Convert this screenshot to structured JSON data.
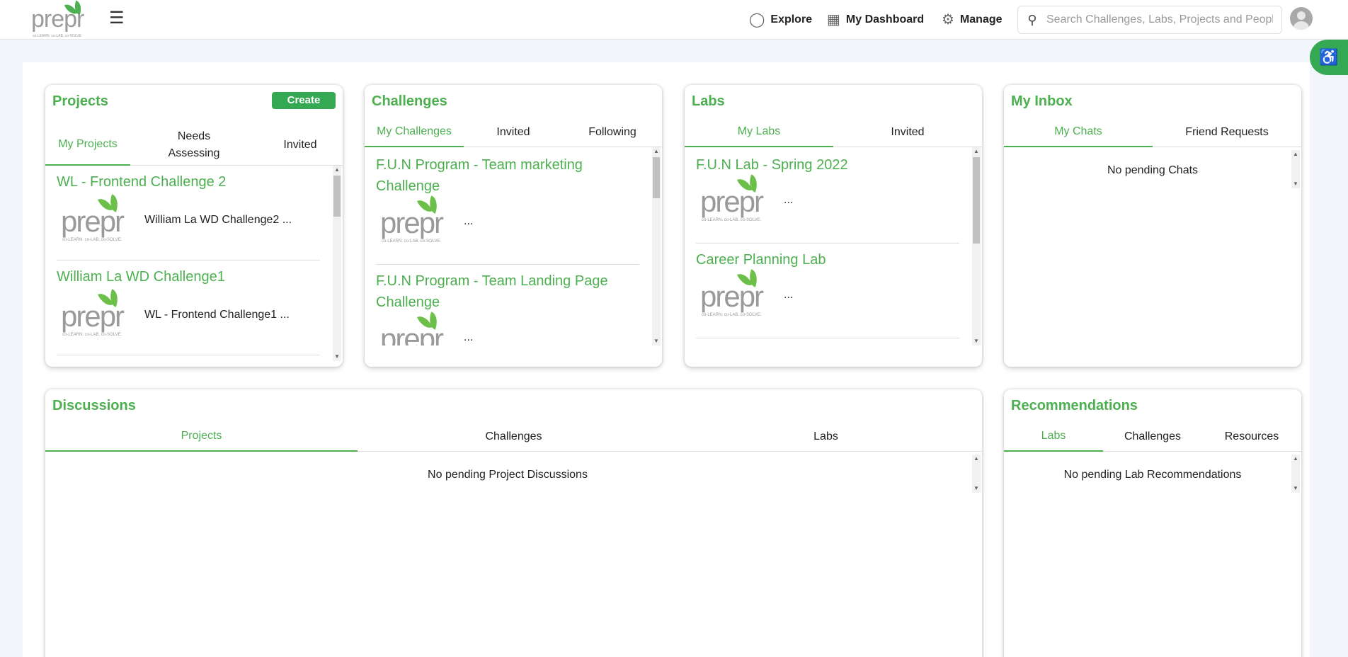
{
  "header": {
    "logo_text": "prepr",
    "logo_tagline": "co-LEARN. co-LAB. co-SOLVE.",
    "nav": [
      {
        "label": "Explore",
        "icon": "binoculars-icon"
      },
      {
        "label": "My Dashboard",
        "icon": "dashboard-icon"
      },
      {
        "label": "Manage",
        "icon": "gear-icon"
      }
    ],
    "search_placeholder": "Search Challenges, Labs, Projects and People"
  },
  "projects": {
    "title": "Projects",
    "create_label": "Create",
    "tabs": [
      "My Projects",
      "Needs Assessing",
      "Invited"
    ],
    "active_tab": 0,
    "items": [
      {
        "title": "WL - Frontend Challenge 2",
        "desc": "William La WD Challenge2 ..."
      },
      {
        "title": "William La WD Challenge1",
        "desc": "WL - Frontend Challenge1 ..."
      }
    ]
  },
  "challenges": {
    "title": "Challenges",
    "tabs": [
      "My Challenges",
      "Invited",
      "Following"
    ],
    "active_tab": 0,
    "items": [
      {
        "title": "F.U.N Program - Team marketing Challenge",
        "desc": "..."
      },
      {
        "title": "F.U.N Program - Team Landing Page Challenge",
        "desc": "..."
      }
    ]
  },
  "labs": {
    "title": "Labs",
    "tabs": [
      "My Labs",
      "Invited"
    ],
    "active_tab": 0,
    "items": [
      {
        "title": "F.U.N Lab - Spring 2022",
        "desc": "..."
      },
      {
        "title": "Career Planning Lab",
        "desc": "..."
      }
    ]
  },
  "inbox": {
    "title": "My Inbox",
    "tabs": [
      "My Chats",
      "Friend Requests"
    ],
    "active_tab": 0,
    "empty_text": "No pending Chats"
  },
  "discussions": {
    "title": "Discussions",
    "tabs": [
      "Projects",
      "Challenges",
      "Labs"
    ],
    "active_tab": 0,
    "empty_text": "No pending Project Discussions"
  },
  "recommendations": {
    "title": "Recommendations",
    "tabs": [
      "Labs",
      "Challenges",
      "Resources"
    ],
    "active_tab": 0,
    "empty_text": "No pending Lab Recommendations"
  },
  "colors": {
    "accent": "#4caf50",
    "button": "#34a853",
    "page_bg": "#f2f5fa"
  }
}
